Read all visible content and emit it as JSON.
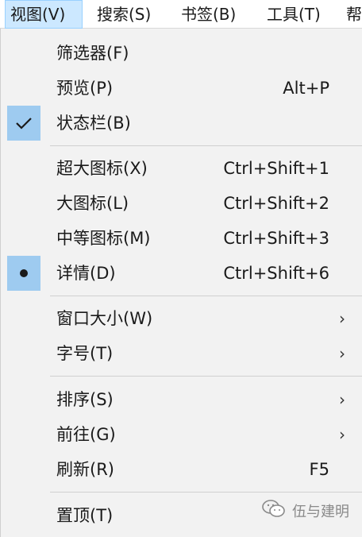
{
  "menubar": {
    "items": [
      {
        "label": "视图(V)"
      },
      {
        "label": "搜索(S)"
      },
      {
        "label": "书签(B)"
      },
      {
        "label": "工具(T)"
      },
      {
        "label": "帮"
      }
    ]
  },
  "view_menu": {
    "items": [
      {
        "label": "筛选器(F)",
        "shortcut": ""
      },
      {
        "label": "预览(P)",
        "shortcut": "Alt+P"
      },
      {
        "label": "状态栏(B)",
        "shortcut": "",
        "checked": true
      },
      {
        "label": "超大图标(X)",
        "shortcut": "Ctrl+Shift+1"
      },
      {
        "label": "大图标(L)",
        "shortcut": "Ctrl+Shift+2"
      },
      {
        "label": "中等图标(M)",
        "shortcut": "Ctrl+Shift+3"
      },
      {
        "label": "详情(D)",
        "shortcut": "Ctrl+Shift+6",
        "selected": true
      },
      {
        "label": "窗口大小(W)",
        "submenu": true
      },
      {
        "label": "字号(T)",
        "submenu": true
      },
      {
        "label": "排序(S)",
        "submenu": true
      },
      {
        "label": "前往(G)",
        "submenu": true
      },
      {
        "label": "刷新(R)",
        "shortcut": "F5"
      },
      {
        "label": "置顶(T)",
        "shortcut": ""
      }
    ]
  },
  "watermark": {
    "text": "伍与建明",
    "icon": "wechat-icon"
  },
  "colors": {
    "menubar_active_bg": "#cce8ff",
    "menu_bg": "#f2f2f2",
    "check_bg": "#9ecbf0"
  }
}
